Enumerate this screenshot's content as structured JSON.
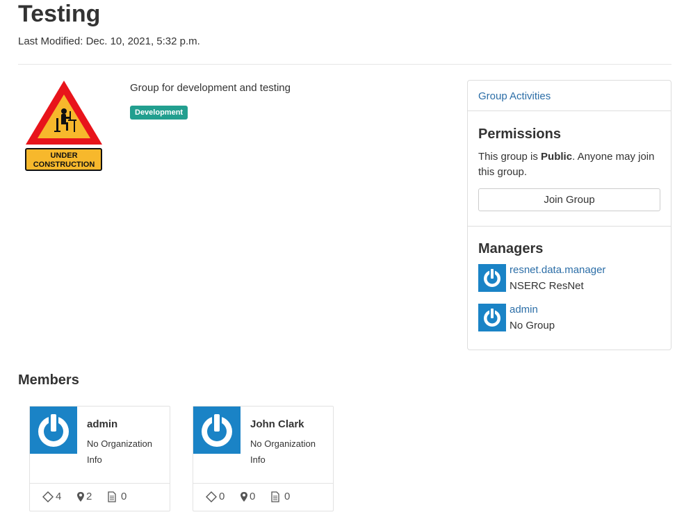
{
  "header": {
    "title": "Testing",
    "last_modified_label": "Last Modified:",
    "last_modified_value": "Dec. 10, 2021, 5:32 p.m."
  },
  "group": {
    "logo_lines": [
      "UNDER",
      "CONSTRUCTION"
    ],
    "description": "Group for development and testing",
    "tag": "Development"
  },
  "sidebar": {
    "activities_link": "Group Activities",
    "permissions": {
      "heading": "Permissions",
      "text_before": "This group is ",
      "text_bold": "Public",
      "text_after": ". Anyone may join this group.",
      "join_button": "Join Group"
    },
    "managers": {
      "heading": "Managers",
      "items": [
        {
          "name": "resnet.data.manager",
          "org": "NSERC ResNet"
        },
        {
          "name": "admin",
          "org": "No Group"
        }
      ]
    }
  },
  "members": {
    "heading": "Members",
    "items": [
      {
        "name": "admin",
        "org_line1": "No Organization",
        "org_line2": "Info",
        "tags": "4",
        "locations": "2",
        "documents": "0"
      },
      {
        "name": "John Clark",
        "org_line1": "No Organization",
        "org_line2": "Info",
        "tags": "0",
        "locations": "0",
        "documents": "0"
      }
    ]
  },
  "colors": {
    "link": "#2c6ea7",
    "tag_badge": "#229f8f",
    "avatar_bg": "#1a83c6",
    "border": "#dddddd"
  },
  "icons": {
    "avatar": "power-icon",
    "tags_stat": "diamond-tag-icon",
    "locations_stat": "map-pin-icon",
    "documents_stat": "document-icon"
  }
}
